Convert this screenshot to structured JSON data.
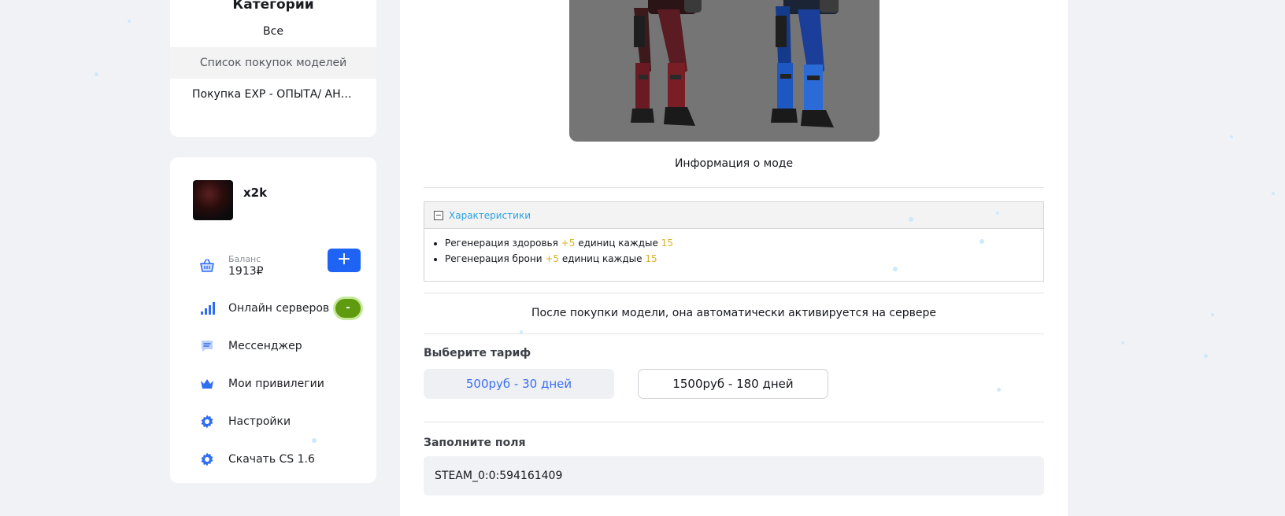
{
  "categories": {
    "title": "Категории",
    "items": [
      {
        "label": "Все"
      },
      {
        "label": "Список покупок моделей"
      },
      {
        "label": "Покупка EXP - ОПЫТА/ АНЕ..."
      }
    ]
  },
  "user": {
    "name": "x2k"
  },
  "menu": {
    "balance_label": "Баланс",
    "balance_value": "1913₽",
    "add_balance": "+",
    "online_servers": "Онлайн серверов",
    "online_badge": "-",
    "messenger": "Мессенджер",
    "privileges": "Мои привилегии",
    "settings": "Настройки",
    "download": "Скачать CS 1.6"
  },
  "main": {
    "info_title": "Информация о моде",
    "spoiler_title": "Характеристики",
    "features": [
      {
        "prefix": "Регенерация здоровья ",
        "amount": "+5",
        "middle": " единиц каждые ",
        "interval": "15"
      },
      {
        "prefix": "Регенерация брони ",
        "amount": "+5",
        "middle": " единиц каждые ",
        "interval": "15"
      }
    ],
    "after_buy": "После покупки модели, она автоматически активируется на сервере",
    "tariff_label": "Выберите тариф",
    "tariffs": [
      {
        "label": "500руб - 30 дней",
        "selected": true
      },
      {
        "label": "1500руб - 180 дней",
        "selected": false
      }
    ],
    "fields_label": "Заполните поля",
    "steam_id": "STEAM_0:0:594161409"
  },
  "colors": {
    "accent": "#1f63f5",
    "online": "#5e9b0f",
    "highlight": "#d8b22a",
    "spoiler_link": "#2aa3e0"
  },
  "icons": [
    "basket-icon",
    "signal-bars-icon",
    "chat-icon",
    "crown-icon",
    "gear-icon",
    "minus-box-icon"
  ]
}
